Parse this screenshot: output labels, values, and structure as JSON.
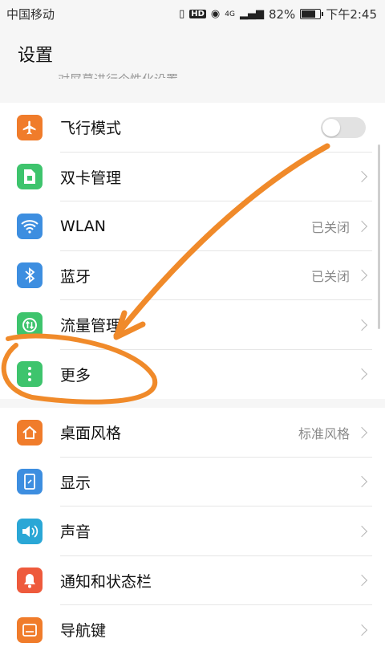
{
  "status_bar": {
    "carrier": "中国移动",
    "network": "4G",
    "hd": "HD",
    "battery_percent": "82%",
    "battery_level": 0.82,
    "time": "下午2:45"
  },
  "header": {
    "title": "设置",
    "cut_text": "对屏幕进行个性化设置"
  },
  "group1": {
    "items": [
      {
        "label": "飞行模式",
        "icon": "airplane-icon",
        "icon_color": "#f07c2b",
        "toggle": false
      },
      {
        "label": "双卡管理",
        "icon": "sim-card-icon",
        "icon_color": "#3ec46d"
      },
      {
        "label": "WLAN",
        "value": "已关闭",
        "icon": "wifi-icon",
        "icon_color": "#3d8ee0"
      },
      {
        "label": "蓝牙",
        "value": "已关闭",
        "icon": "bluetooth-icon",
        "icon_color": "#3d8ee0"
      },
      {
        "label": "流量管理",
        "icon": "data-usage-icon",
        "icon_color": "#3ec46d"
      },
      {
        "label": "更多",
        "icon": "more-icon",
        "icon_color": "#3ec46d"
      }
    ]
  },
  "group2": {
    "items": [
      {
        "label": "桌面风格",
        "value": "标准风格",
        "icon": "home-style-icon",
        "icon_color": "#f07c2b"
      },
      {
        "label": "显示",
        "icon": "display-icon",
        "icon_color": "#3d8ee0"
      },
      {
        "label": "声音",
        "icon": "sound-icon",
        "icon_color": "#2aa7d6"
      },
      {
        "label": "通知和状态栏",
        "icon": "notification-icon",
        "icon_color": "#ee5a3c"
      },
      {
        "label": "导航键",
        "icon": "navigation-key-icon",
        "icon_color": "#f07c2b"
      }
    ]
  },
  "colors": {
    "annotation": "#f08a2a",
    "background": "#f6f6f6"
  }
}
